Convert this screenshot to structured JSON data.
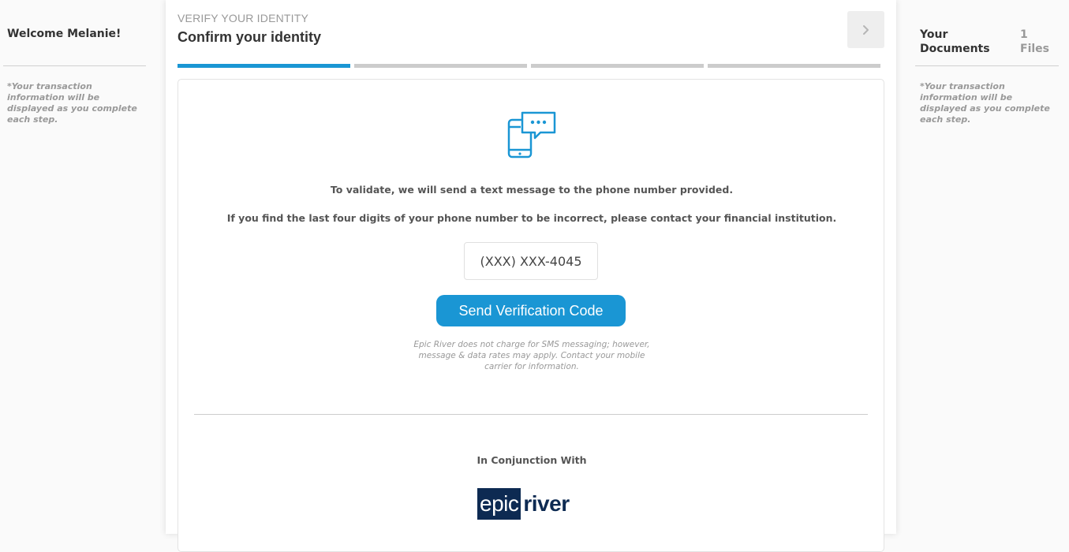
{
  "left_sidebar": {
    "welcome": "Welcome Melanie!",
    "note": "*Your transaction information will be displayed as you complete each step."
  },
  "header": {
    "step_label": "VERIFY YOUR IDENTITY",
    "title": "Confirm your identity",
    "next_icon": "chevron-right-icon"
  },
  "progress": {
    "total_steps": 4,
    "current_step": 1
  },
  "verification": {
    "icon": "sms-phone-icon",
    "instruction_1": "To validate, we will send a text message to the phone number provided.",
    "instruction_2": "If you find the last four digits of your phone number to be incorrect, please contact your financial institution.",
    "phone_masked": "(XXX) XXX-4045",
    "send_button_label": "Send Verification Code",
    "disclaimer": "Epic River does not charge for SMS messaging; however, message & data rates may apply. Contact your mobile carrier for information."
  },
  "footer": {
    "conjunction_label": "In Conjunction With",
    "logo_left": "epic",
    "logo_right": "river"
  },
  "right_sidebar": {
    "title": "Your Documents",
    "files_count": "1 Files",
    "note": "*Your transaction information will be displayed as you complete each step."
  },
  "colors": {
    "accent": "#1a96d4",
    "logo_navy": "#0d2a52",
    "progress_inactive": "#cccccc"
  }
}
